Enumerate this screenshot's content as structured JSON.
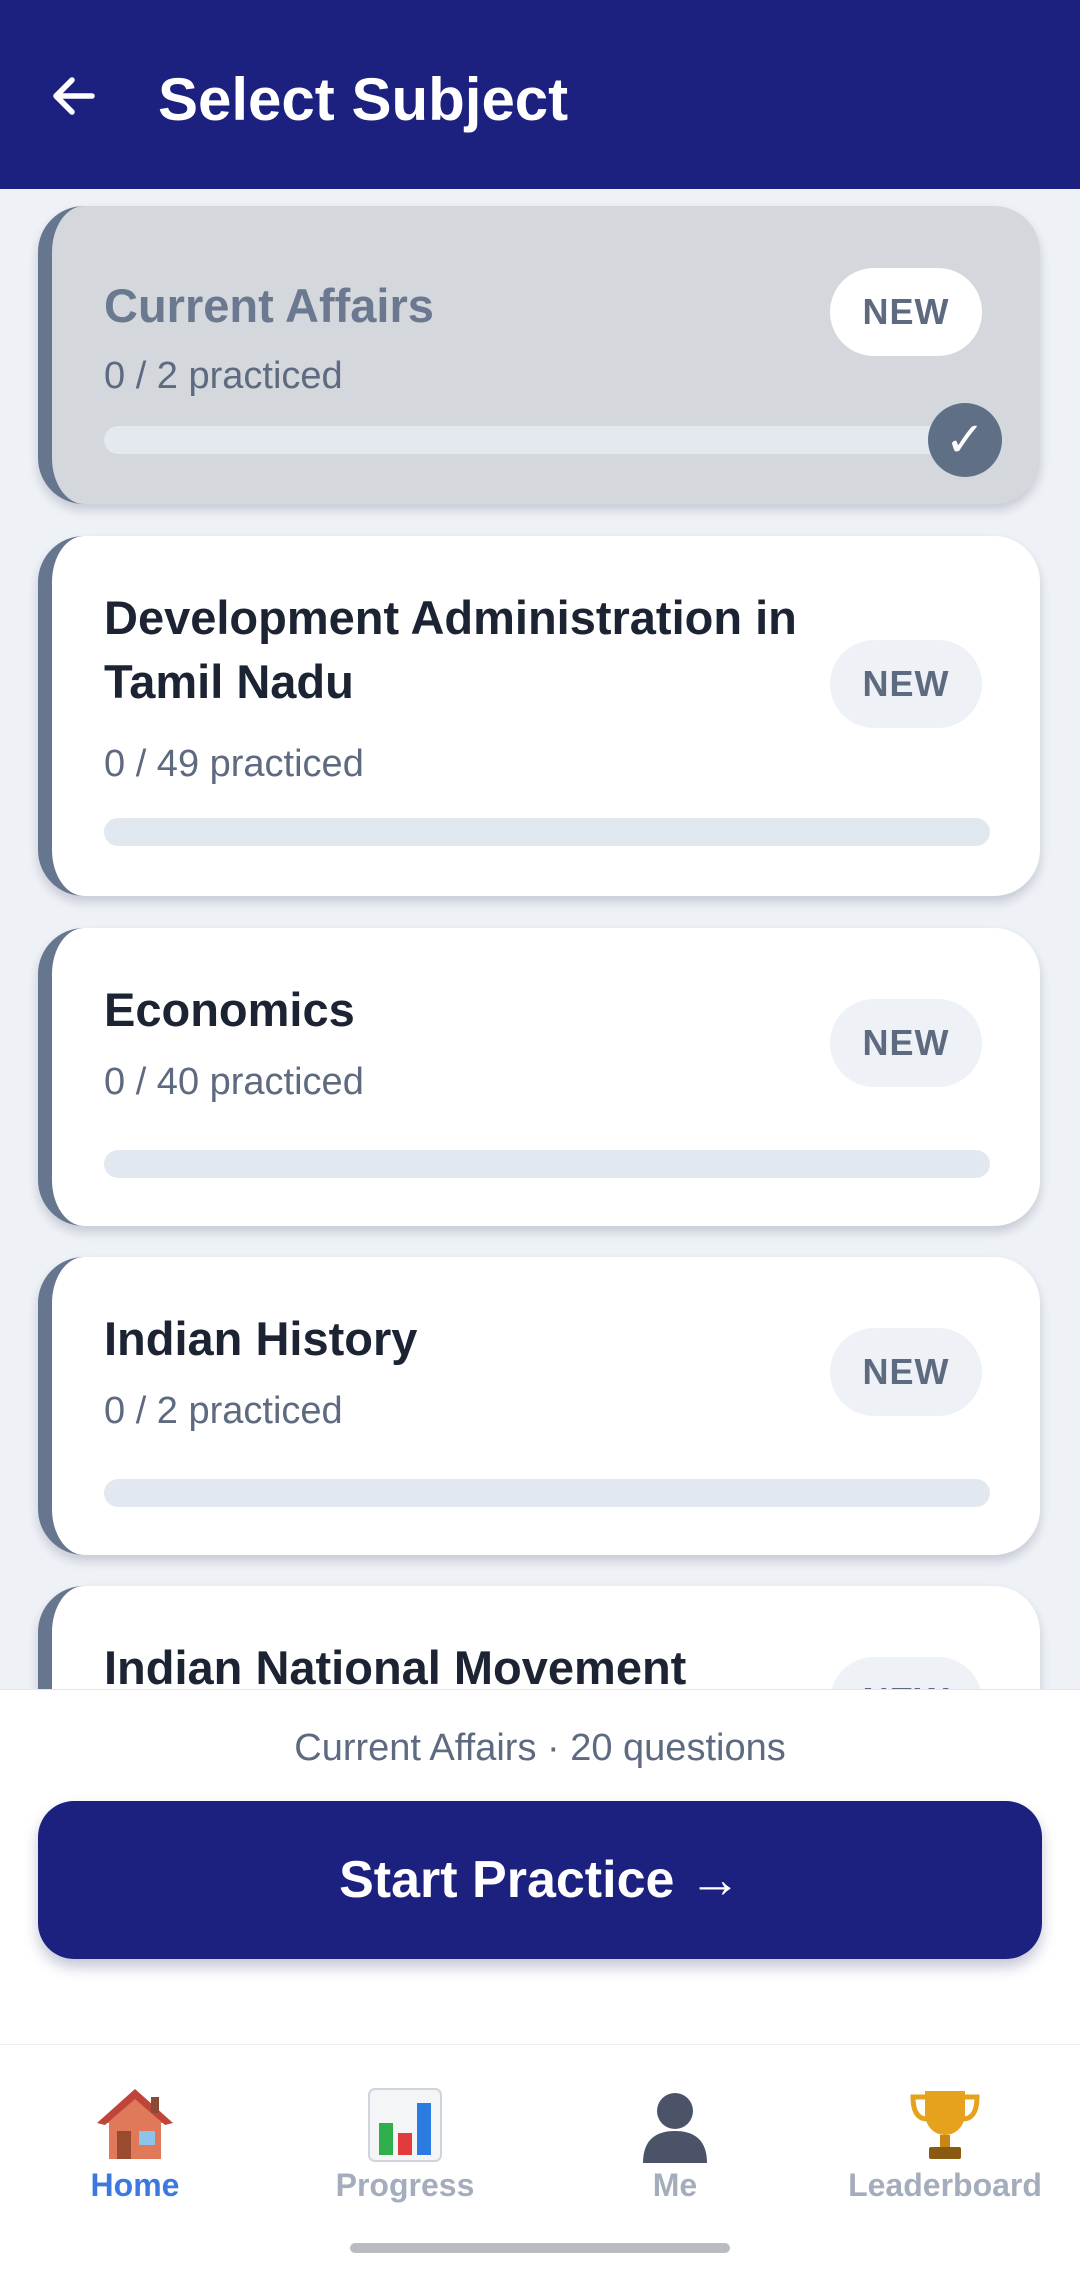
{
  "header": {
    "title": "Select Subject"
  },
  "subjects": [
    {
      "title": "Current Affairs",
      "practiced": "0 / 2 practiced",
      "badge": "NEW",
      "progress": 0,
      "selected": true,
      "check": "✓"
    },
    {
      "title": "Development Administration in Tamil Nadu",
      "practiced": "0 / 49 practiced",
      "badge": "NEW",
      "progress": 0,
      "selected": false
    },
    {
      "title": "Economics",
      "practiced": "0 / 40 practiced",
      "badge": "NEW",
      "progress": 0,
      "selected": false
    },
    {
      "title": "Indian History",
      "practiced": "0 / 2 practiced",
      "badge": "NEW",
      "progress": 0,
      "selected": false
    },
    {
      "title": "Indian National Movement",
      "badge": "NEW",
      "progress": 0,
      "selected": false
    }
  ],
  "summary": "Current Affairs · 20 questions",
  "start_button": "Start Practice →",
  "tabs": [
    {
      "label": "Home",
      "icon": "home-icon",
      "active": true
    },
    {
      "label": "Progress",
      "icon": "chart-icon",
      "active": false
    },
    {
      "label": "Me",
      "icon": "user-icon",
      "active": false
    },
    {
      "label": "Leaderboard",
      "icon": "trophy-icon",
      "active": false
    }
  ],
  "colors": {
    "primary": "#1c2180",
    "active_tab": "#3b78e0",
    "inactive_tab": "#a4adbb",
    "accent_border": "#66768e"
  }
}
